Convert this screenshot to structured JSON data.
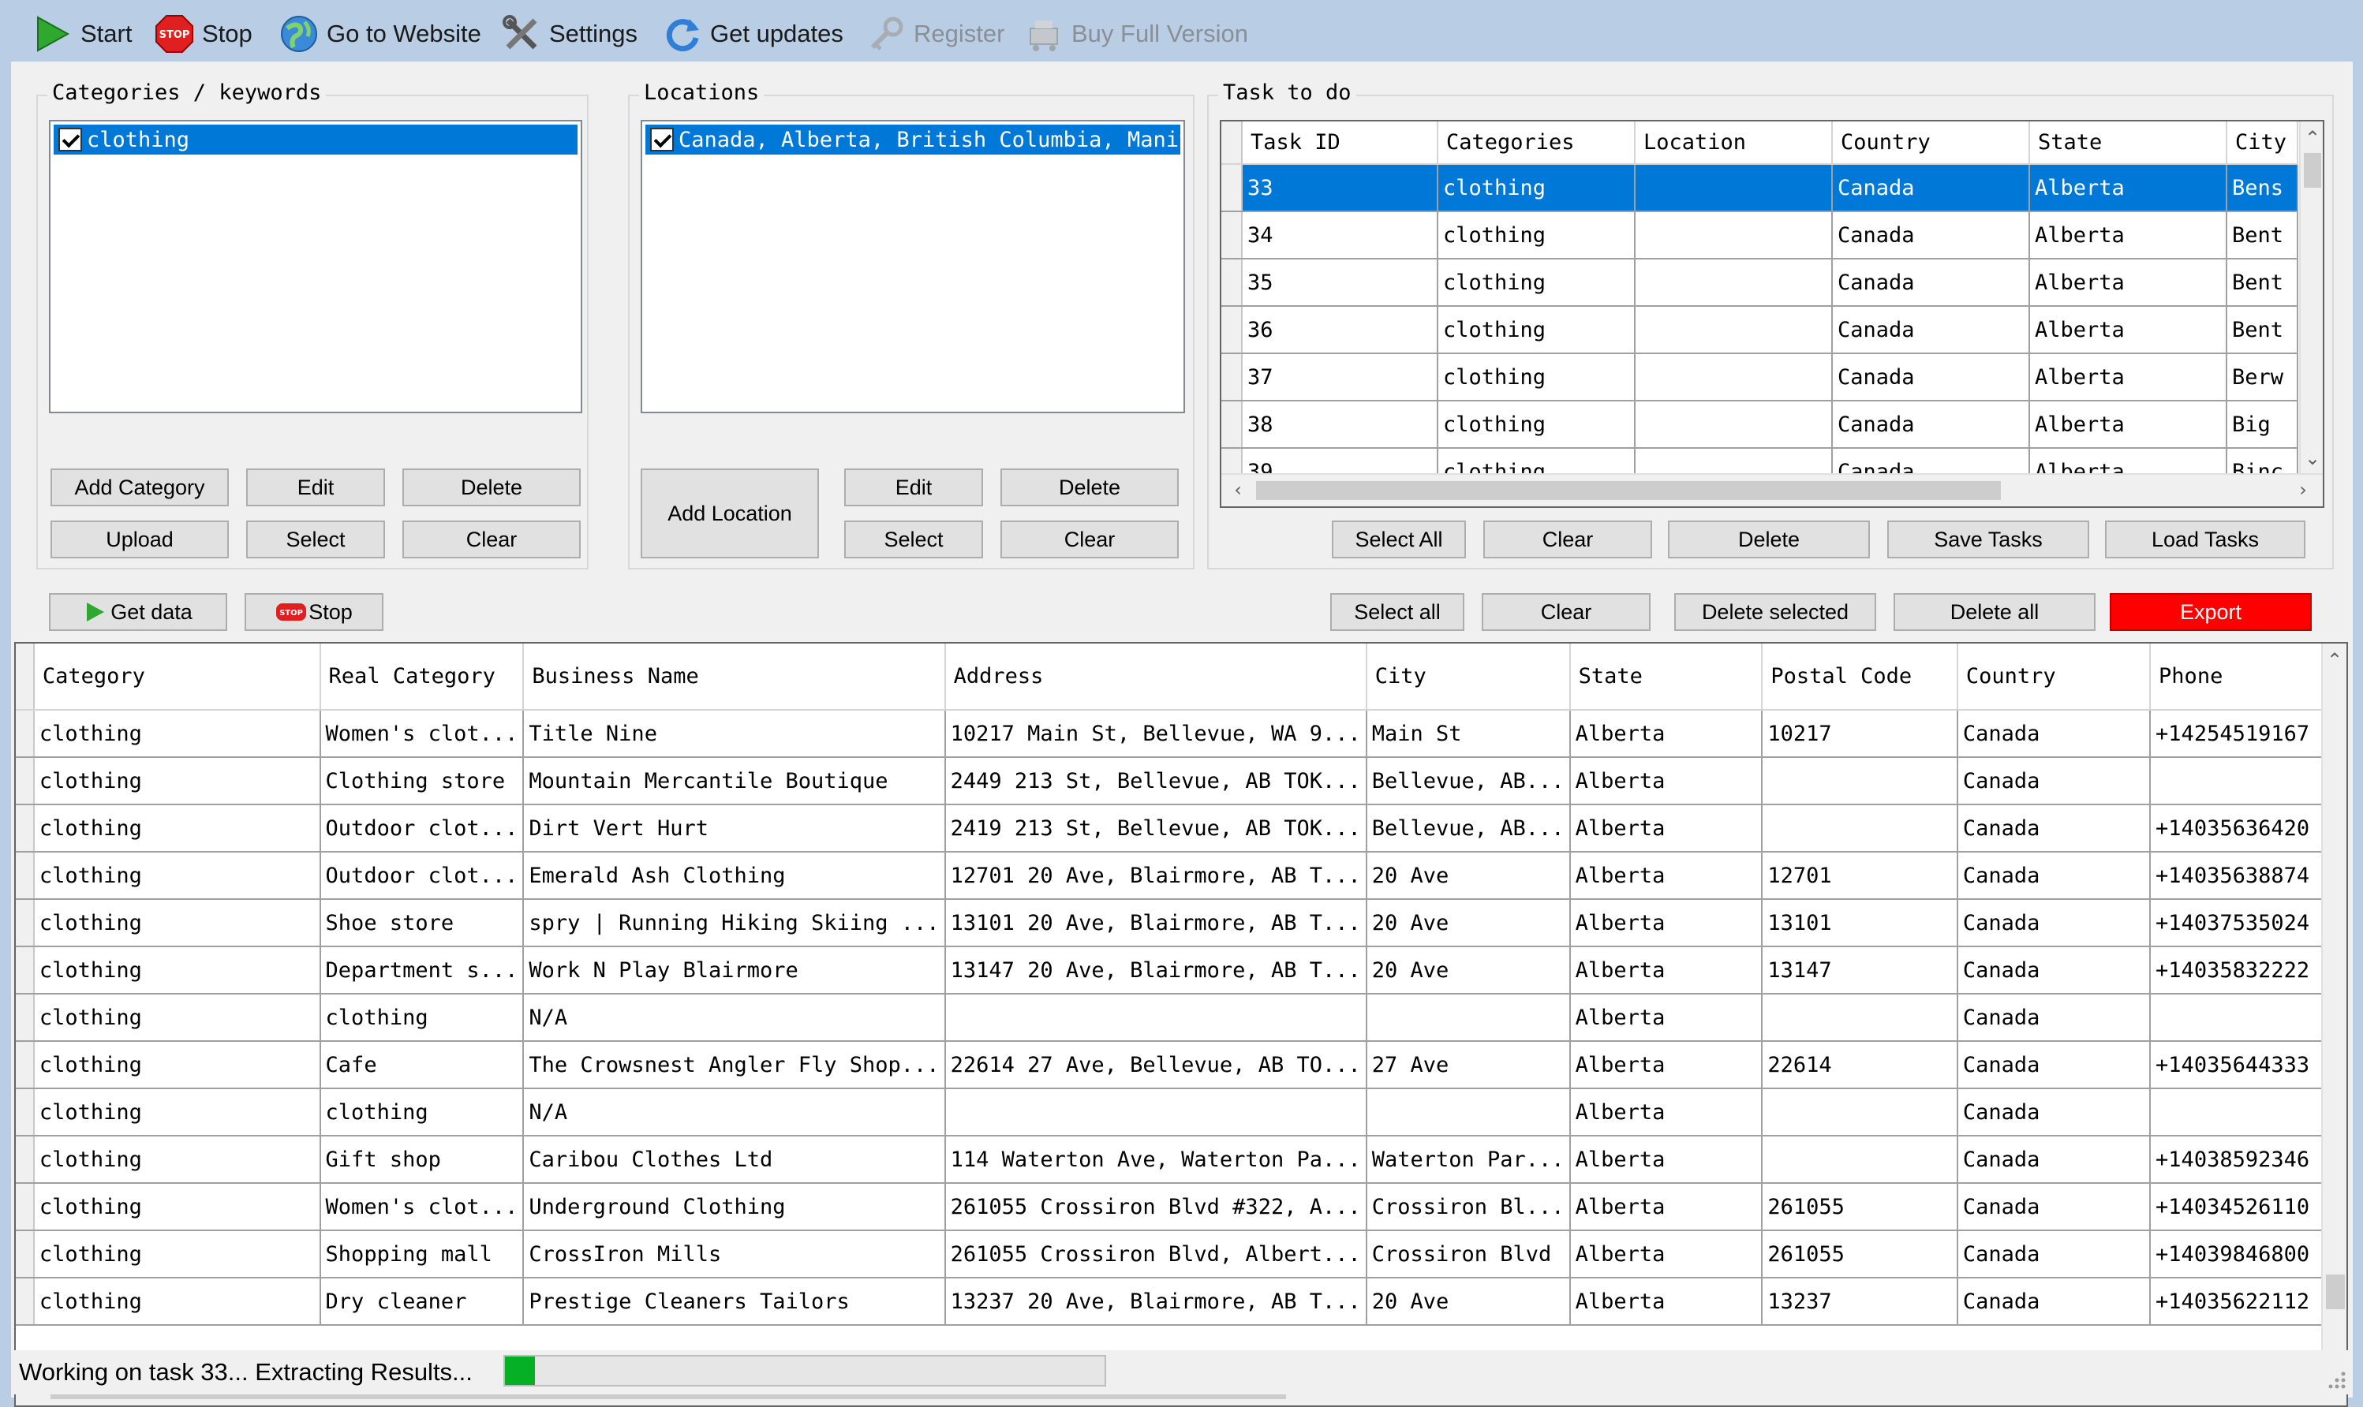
{
  "toolbar": {
    "start": "Start",
    "stop": "Stop",
    "go_to_website": "Go to Website",
    "settings": "Settings",
    "get_updates": "Get updates",
    "register": "Register",
    "buy_full_version": "Buy Full Version"
  },
  "categories_panel": {
    "title": "Categories / keywords",
    "items": [
      {
        "label": "clothing",
        "checked": true
      }
    ],
    "buttons": {
      "add": "Add Category",
      "edit": "Edit",
      "delete": "Delete",
      "upload": "Upload",
      "select": "Select",
      "clear": "Clear"
    }
  },
  "locations_panel": {
    "title": "Locations",
    "items": [
      {
        "label": "Canada, Alberta, British Columbia, Manitoba",
        "checked": true
      }
    ],
    "buttons": {
      "add": "Add Location",
      "edit": "Edit",
      "delete": "Delete",
      "select": "Select",
      "clear": "Clear"
    }
  },
  "tasks_panel": {
    "title": "Task to do",
    "columns": [
      "Task ID",
      "Categories",
      "Location",
      "Country",
      "State",
      "City"
    ],
    "rows": [
      [
        "33",
        "clothing",
        "",
        "Canada",
        "Alberta",
        "Bens"
      ],
      [
        "34",
        "clothing",
        "",
        "Canada",
        "Alberta",
        "Bent"
      ],
      [
        "35",
        "clothing",
        "",
        "Canada",
        "Alberta",
        "Bent"
      ],
      [
        "36",
        "clothing",
        "",
        "Canada",
        "Alberta",
        "Bent"
      ],
      [
        "37",
        "clothing",
        "",
        "Canada",
        "Alberta",
        "Berw"
      ],
      [
        "38",
        "clothing",
        "",
        "Canada",
        "Alberta",
        "Big "
      ],
      [
        "39",
        "clothing",
        "",
        "Canada",
        "Alberta",
        "Binc"
      ]
    ],
    "selected_row": 0,
    "buttons": {
      "select_all": "Select All",
      "clear": "Clear",
      "delete": "Delete",
      "save": "Save Tasks",
      "load": "Load Tasks"
    }
  },
  "results_bar": {
    "get_data": "Get data",
    "stop": "Stop",
    "select_all": "Select all",
    "clear": "Clear",
    "delete_selected": "Delete selected",
    "delete_all": "Delete all",
    "export": "Export"
  },
  "results": {
    "columns": [
      "Category",
      "Real Category",
      "Business Name",
      "Address",
      "City",
      "State",
      "Postal Code",
      "Country",
      "Phone"
    ],
    "rows": [
      [
        "clothing",
        "Women's clot...",
        "Title Nine",
        "10217 Main St, Bellevue, WA 9...",
        "Main St",
        "Alberta",
        "10217",
        "Canada",
        "+14254519167"
      ],
      [
        "clothing",
        "Clothing store",
        "Mountain Mercantile Boutique",
        "2449 213 St, Bellevue, AB TOK...",
        "Bellevue, AB...",
        "Alberta",
        "",
        "Canada",
        ""
      ],
      [
        "clothing",
        "Outdoor clot...",
        "Dirt Vert Hurt",
        "2419 213 St, Bellevue, AB TOK...",
        "Bellevue, AB...",
        "Alberta",
        "",
        "Canada",
        "+14035636420"
      ],
      [
        "clothing",
        "Outdoor clot...",
        "Emerald  Ash Clothing",
        "12701 20 Ave, Blairmore, AB T...",
        "20 Ave",
        "Alberta",
        "12701",
        "Canada",
        "+14035638874"
      ],
      [
        "clothing",
        "Shoe store",
        "spry | Running Hiking Skiing ...",
        "13101 20 Ave, Blairmore, AB T...",
        "20 Ave",
        "Alberta",
        "13101",
        "Canada",
        "+14037535024"
      ],
      [
        "clothing",
        "Department s...",
        "Work N Play Blairmore",
        "13147 20 Ave, Blairmore, AB T...",
        "20 Ave",
        "Alberta",
        "13147",
        "Canada",
        "+14035832222"
      ],
      [
        "clothing",
        "clothing",
        "N/A",
        "",
        "",
        "Alberta",
        "",
        "Canada",
        ""
      ],
      [
        "clothing",
        "Cafe",
        "The Crowsnest Angler Fly Shop...",
        "22614 27 Ave, Bellevue, AB TO...",
        "27 Ave",
        "Alberta",
        "22614",
        "Canada",
        "+14035644333"
      ],
      [
        "clothing",
        "clothing",
        "N/A",
        "",
        "",
        "Alberta",
        "",
        "Canada",
        ""
      ],
      [
        "clothing",
        "Gift shop",
        "Caribou Clothes Ltd",
        "114 Waterton Ave, Waterton Pa...",
        "Waterton Par...",
        "Alberta",
        "",
        "Canada",
        "+14038592346"
      ],
      [
        "clothing",
        "Women's clot...",
        "Underground Clothing",
        "261055 Crossiron Blvd #322, A...",
        "Crossiron Bl...",
        "Alberta",
        "261055",
        "Canada",
        "+14034526110"
      ],
      [
        "clothing",
        "Shopping mall",
        "CrossIron Mills",
        "261055 Crossiron Blvd, Albert...",
        "Crossiron Blvd",
        "Alberta",
        "261055",
        "Canada",
        "+14039846800"
      ],
      [
        "clothing",
        "Dry cleaner",
        "Prestige Cleaners  Tailors",
        "13237 20 Ave, Blairmore, AB T...",
        "20 Ave",
        "Alberta",
        "13237",
        "Canada",
        "+14035622112"
      ]
    ]
  },
  "status": {
    "text": "Working on task 33... Extracting Results...",
    "progress_fraction": 0.05
  },
  "colors": {
    "selection": "#0078d7",
    "export_button": "#ff0000",
    "progress": "#06b025",
    "window_bg": "#b9cde5"
  }
}
